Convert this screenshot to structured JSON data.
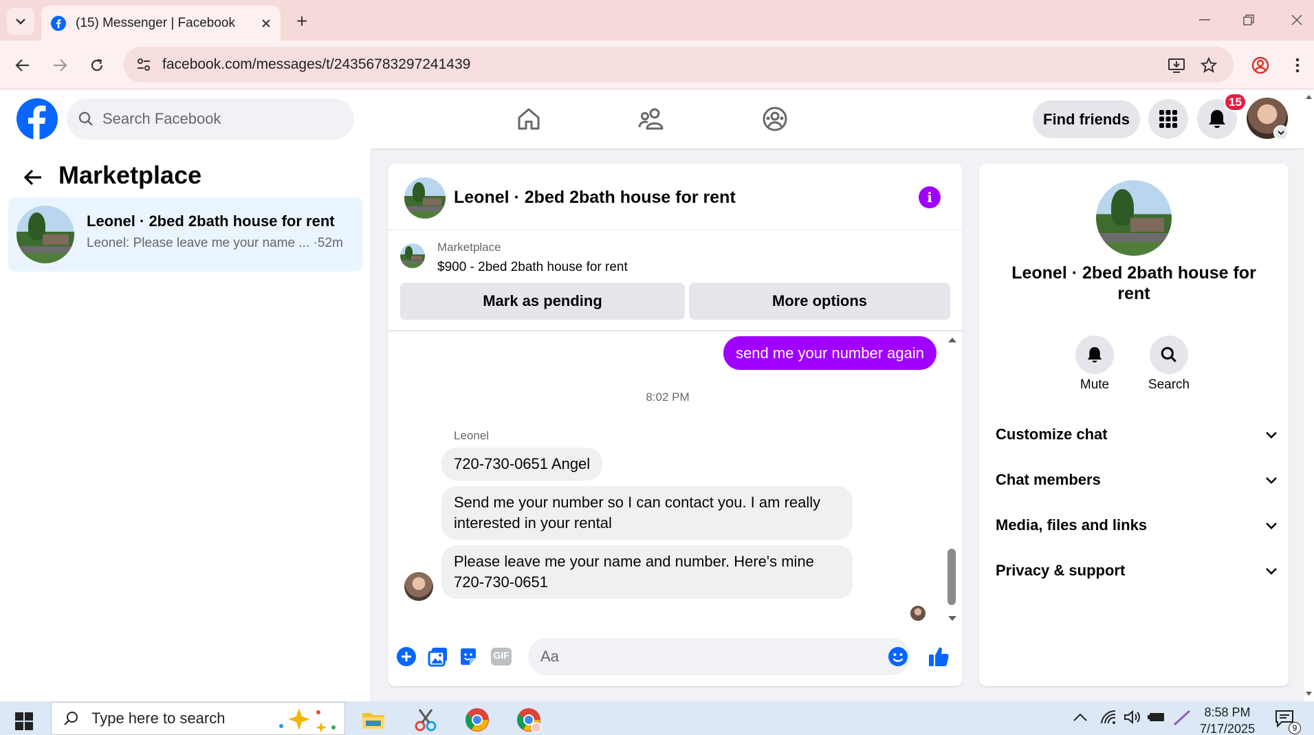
{
  "browser": {
    "tab_title": "(15) Messenger | Facebook",
    "url": "facebook.com/messages/t/24356783297241439",
    "new_tab_label": "+"
  },
  "header": {
    "search_placeholder": "Search Facebook",
    "find_friends_label": "Find friends",
    "notification_count": "15"
  },
  "left_panel": {
    "title": "Marketplace",
    "conversation": {
      "name": "Leonel · 2bed 2bath house for rent",
      "preview": "Leonel: Please leave me your name ... ·52m"
    }
  },
  "chat": {
    "title": "Leonel · 2bed 2bath house for rent",
    "listing": {
      "label": "Marketplace",
      "price_title": "$900 - 2bed 2bath house for rent",
      "mark_pending_label": "Mark as pending",
      "more_options_label": "More options"
    },
    "messages": {
      "sent": "send me your number again",
      "timestamp": "8:02 PM",
      "sender": "Leonel",
      "received": [
        "720-730-0651 Angel",
        "Send me your number so I can contact you. I am really interested in your rental",
        "Please leave me your name and number. Here's mine 720-730-0651"
      ]
    },
    "composer_placeholder": "Aa",
    "gif_label": "GIF"
  },
  "info_panel": {
    "name": "Leonel · 2bed 2bath house for rent",
    "mute_label": "Mute",
    "search_label": "Search",
    "sections": [
      "Customize chat",
      "Chat members",
      "Media, files and links",
      "Privacy & support"
    ]
  },
  "taskbar": {
    "search_placeholder": "Type here to search",
    "time": "8:58 PM",
    "date": "7/17/2025",
    "notification_count": "9"
  },
  "colors": {
    "accent": "#a000ff",
    "fb_blue": "#0866ff",
    "notification_red": "#e41e3f"
  }
}
